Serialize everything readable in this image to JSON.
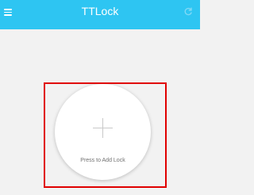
{
  "app_bar": {
    "title": "TTLock",
    "menu_icon": "hamburger-menu-icon",
    "right_icon": "refresh-icon",
    "background_color": "#2ec5f2"
  },
  "main": {
    "add_lock_label": "Press to Add Lock",
    "add_icon": "plus-icon",
    "highlight_color": "#e00000"
  }
}
